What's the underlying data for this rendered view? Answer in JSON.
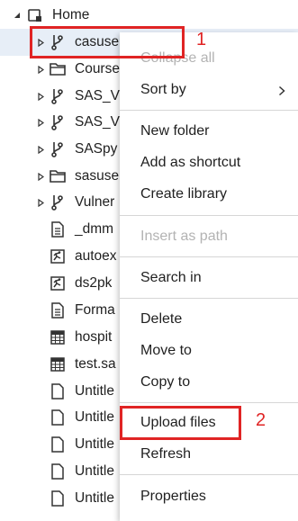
{
  "tree": {
    "root_label": "Home",
    "items": [
      {
        "label": "casuse",
        "icon": "git-repo-icon",
        "expandable": true,
        "selected": true
      },
      {
        "label": "Course",
        "icon": "folder-icon",
        "expandable": true
      },
      {
        "label": "SAS_V",
        "icon": "git-repo-icon",
        "expandable": true
      },
      {
        "label": "SAS_V",
        "icon": "git-repo-icon",
        "expandable": true
      },
      {
        "label": "SASpy",
        "icon": "git-repo-icon",
        "expandable": true
      },
      {
        "label": "sasuse",
        "icon": "folder-icon",
        "expandable": true
      },
      {
        "label": "Vulner",
        "icon": "git-repo-icon",
        "expandable": true
      },
      {
        "label": "_dmm",
        "icon": "document-icon",
        "expandable": false
      },
      {
        "label": "autoex",
        "icon": "sas-program-icon",
        "expandable": false
      },
      {
        "label": "ds2pk",
        "icon": "sas-program-icon",
        "expandable": false
      },
      {
        "label": "Forma",
        "icon": "document-icon",
        "expandable": false
      },
      {
        "label": "hospit",
        "icon": "sas-dataset-icon",
        "expandable": false
      },
      {
        "label": "test.sa",
        "icon": "sas-dataset-icon",
        "expandable": false
      },
      {
        "label": "Untitle",
        "icon": "blank-file-icon",
        "expandable": false
      },
      {
        "label": "Untitle",
        "icon": "blank-file-icon",
        "expandable": false
      },
      {
        "label": "Untitle",
        "icon": "blank-file-icon",
        "expandable": false
      },
      {
        "label": "Untitle",
        "icon": "blank-file-icon",
        "expandable": false
      },
      {
        "label": "Untitle",
        "icon": "blank-file-icon",
        "expandable": false
      }
    ]
  },
  "context_menu": {
    "collapse_all": "Collapse all",
    "sort_by": "Sort by",
    "new_folder": "New folder",
    "add_as_shortcut": "Add as shortcut",
    "create_library": "Create library",
    "insert_as_path": "Insert as path",
    "search_in": "Search in",
    "delete": "Delete",
    "move_to": "Move to",
    "copy_to": "Copy to",
    "upload_files": "Upload files",
    "refresh": "Refresh",
    "properties": "Properties"
  },
  "annotations": {
    "step1": "1",
    "step2": "2",
    "highlight_color": "#e02424"
  },
  "colors": {
    "selected_row": "#e7eef7",
    "icon": "#333333",
    "disabled_text": "#b3b3b3"
  }
}
